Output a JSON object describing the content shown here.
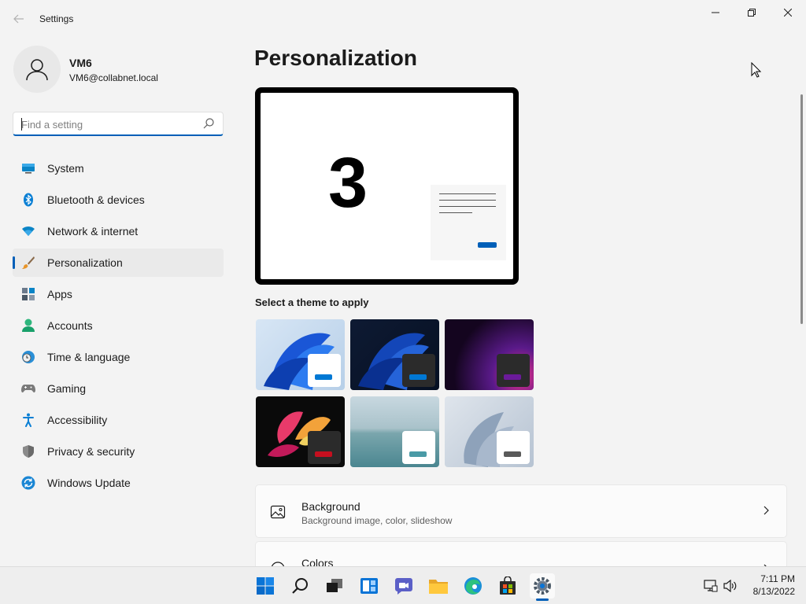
{
  "window": {
    "title": "Settings",
    "back_icon": "back-arrow-icon",
    "controls": {
      "minimize_icon": "minimize-icon",
      "maximize_icon": "restore-icon",
      "close_icon": "close-icon"
    }
  },
  "profile": {
    "name": "VM6",
    "email": "VM6@collabnet.local",
    "avatar_icon": "person-icon"
  },
  "search": {
    "placeholder": "Find a setting",
    "value": "",
    "icon": "search-icon"
  },
  "sidebar": {
    "items": [
      {
        "label": "System",
        "icon": "monitor-icon",
        "selected": false
      },
      {
        "label": "Bluetooth & devices",
        "icon": "bluetooth-icon",
        "selected": false
      },
      {
        "label": "Network & internet",
        "icon": "wifi-icon",
        "selected": false
      },
      {
        "label": "Personalization",
        "icon": "brush-icon",
        "selected": true
      },
      {
        "label": "Apps",
        "icon": "apps-icon",
        "selected": false
      },
      {
        "label": "Accounts",
        "icon": "person-icon",
        "selected": false
      },
      {
        "label": "Time & language",
        "icon": "globe-clock-icon",
        "selected": false
      },
      {
        "label": "Gaming",
        "icon": "gamepad-icon",
        "selected": false
      },
      {
        "label": "Accessibility",
        "icon": "accessibility-icon",
        "selected": false
      },
      {
        "label": "Privacy & security",
        "icon": "shield-icon",
        "selected": false
      },
      {
        "label": "Windows Update",
        "icon": "update-icon",
        "selected": false
      }
    ]
  },
  "main": {
    "title": "Personalization",
    "preview": {
      "number": "3"
    },
    "themes_label": "Select a theme to apply",
    "themes": [
      {
        "name": "windows-light",
        "accent": "#0078d4"
      },
      {
        "name": "windows-dark",
        "accent": "#0078d4"
      },
      {
        "name": "glow",
        "accent": "#6b1a9a"
      },
      {
        "name": "captured-motion",
        "accent": "#c50f1f"
      },
      {
        "name": "sunrise",
        "accent": "#4a9aa6"
      },
      {
        "name": "flow",
        "accent": "#5a5a5a"
      }
    ],
    "cards": [
      {
        "title": "Background",
        "subtitle": "Background image, color, slideshow",
        "icon": "image-icon"
      },
      {
        "title": "Colors",
        "subtitle": "",
        "icon": "palette-icon"
      }
    ]
  },
  "taskbar": {
    "icons": [
      "start-icon",
      "search-icon",
      "task-view-icon",
      "widgets-icon",
      "chat-icon",
      "file-explorer-icon",
      "edge-icon",
      "store-icon",
      "settings-icon"
    ],
    "active": "settings-icon",
    "time": "7:11 PM",
    "date": "8/13/2022"
  },
  "colors": {
    "accent": "#005fb8",
    "background": "#f3f3f3"
  }
}
